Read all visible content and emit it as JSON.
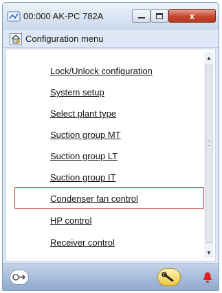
{
  "window": {
    "title": "00:000 AK-PC 782A",
    "close_glyph": "x"
  },
  "header": {
    "title": "Configuration menu",
    "icon": "home-gear-icon"
  },
  "menu": {
    "items": [
      {
        "label": "Lock/Unlock configuration"
      },
      {
        "label": "System setup"
      },
      {
        "label": "Select plant type"
      },
      {
        "label": "Suction group MT"
      },
      {
        "label": "Suction group LT"
      },
      {
        "label": "Suction group IT"
      },
      {
        "label": "Condenser fan control",
        "selected": true
      },
      {
        "label": "HP control"
      },
      {
        "label": "Receiver control"
      }
    ]
  },
  "scrollbar": {
    "up_icon": "arrow-up-icon",
    "down_icon": "arrow-down-icon"
  },
  "bottom_bar": {
    "left_icon": "logout-icon",
    "wrench_icon": "wrench-icon",
    "alarm_icon": "bell-icon",
    "alarm_color": "#e02020"
  }
}
